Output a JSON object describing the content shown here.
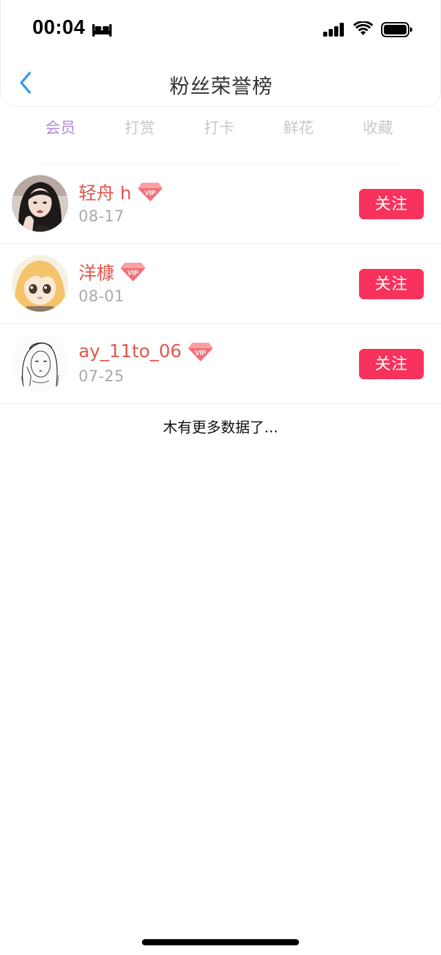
{
  "status_bar": {
    "time": "00:04",
    "sleep_icon": "bed-icon",
    "signal_icon": "signal-icon",
    "wifi_icon": "wifi-icon",
    "battery_icon": "battery-icon"
  },
  "nav": {
    "back_icon": "chevron-left-icon",
    "title": "粉丝荣誉榜"
  },
  "tabs": [
    {
      "label": "会员",
      "active": true
    },
    {
      "label": "打赏",
      "active": false
    },
    {
      "label": "打卡",
      "active": false
    },
    {
      "label": "鲜花",
      "active": false
    },
    {
      "label": "收藏",
      "active": false
    }
  ],
  "fans": [
    {
      "name": "轻舟 h",
      "date": "08-17",
      "badge": "VIP",
      "button": "关注"
    },
    {
      "name": "洋槺",
      "date": "08-01",
      "badge": "VIP",
      "button": "关注"
    },
    {
      "name": "ay_11to_06",
      "date": "07-25",
      "badge": "VIP",
      "button": "关注"
    }
  ],
  "footer_text": "木有更多数据了...",
  "colors": {
    "accent_tab": "#b08ad8",
    "username": "#e2574c",
    "follow_button": "#f7325c",
    "back_icon": "#3a9be3"
  }
}
